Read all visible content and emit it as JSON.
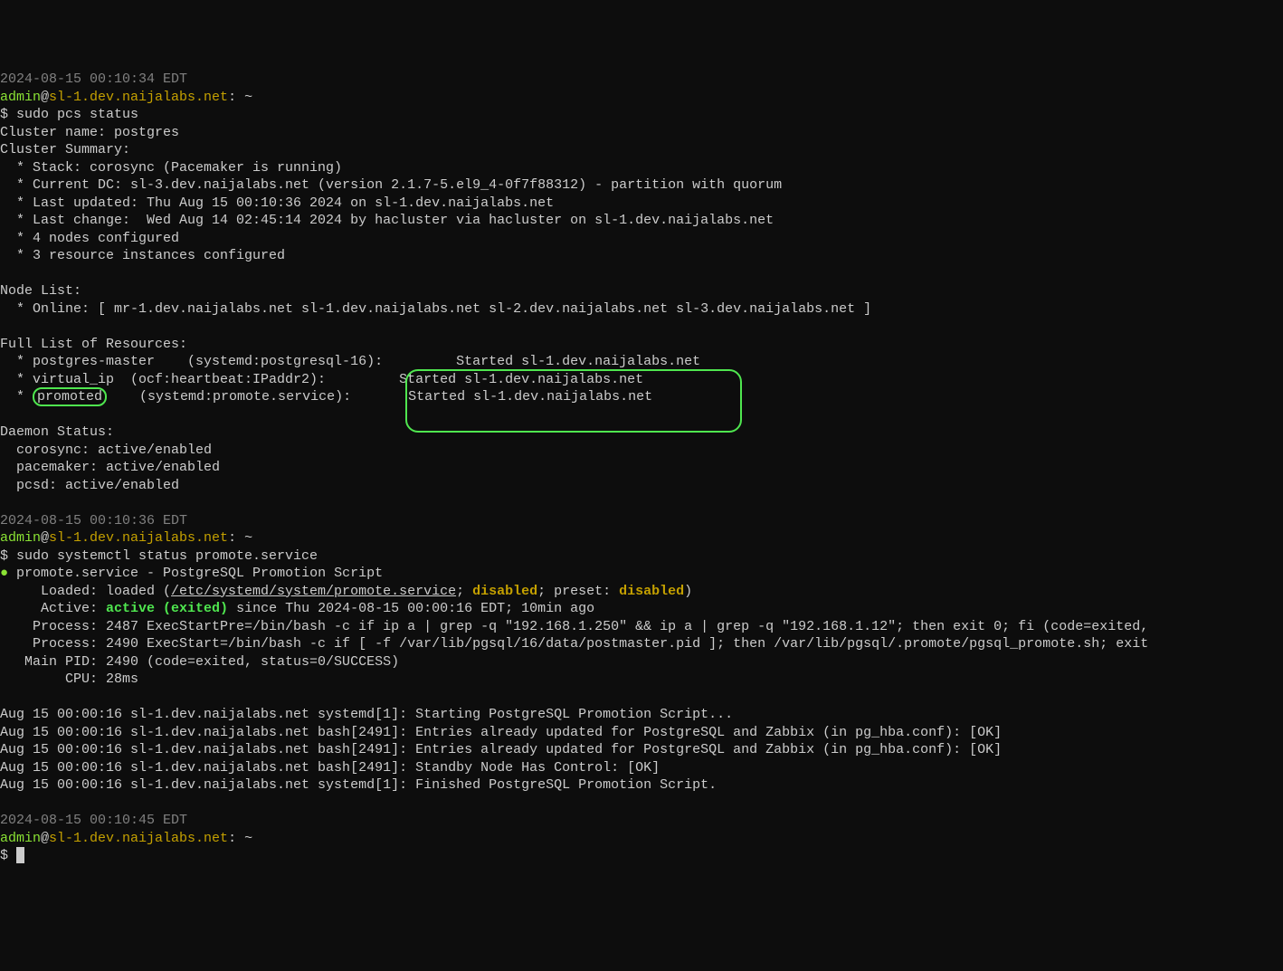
{
  "ts1": "2024-08-15 00:10:34 EDT",
  "user": "admin",
  "at": "@",
  "host": "sl-1.dev.naijalabs.net",
  "prompt_tail": ": ~",
  "cmd1": "$ sudo pcs status",
  "cluster_name": "Cluster name: postgres",
  "cluster_summary": "Cluster Summary:",
  "stack": "  * Stack: corosync (Pacemaker is running)",
  "dc": "  * Current DC: sl-3.dev.naijalabs.net (version 2.1.7-5.el9_4-0f7f88312) - partition with quorum",
  "last_updated": "  * Last updated: Thu Aug 15 00:10:36 2024 on sl-1.dev.naijalabs.net",
  "last_change": "  * Last change:  Wed Aug 14 02:45:14 2024 by hacluster via hacluster on sl-1.dev.naijalabs.net",
  "nodes_conf": "  * 4 nodes configured",
  "res_conf": "  * 3 resource instances configured",
  "node_list_hdr": "Node List:",
  "node_list": "  * Online: [ mr-1.dev.naijalabs.net sl-1.dev.naijalabs.net sl-2.dev.naijalabs.net sl-3.dev.naijalabs.net ]",
  "full_list_hdr": "Full List of Resources:",
  "res1_a": "  * postgres-master    (systemd:postgresql-16):",
  "res1_b": "         Started sl-1.dev.naijalabs.net",
  "res2": "  * virtual_ip  (ocf:heartbeat:IPaddr2):         Started sl-1.dev.naijalabs.net",
  "res3_a": "  * ",
  "res3_hl": "promoted",
  "res3_b": "    (systemd:promote.service):       Started sl-1.dev.naijalabs.net",
  "daemon_hdr": "Daemon Status:",
  "d1": "  corosync: active/enabled",
  "d2": "  pacemaker: active/enabled",
  "d3": "  pcsd: active/enabled",
  "ts2": "2024-08-15 00:10:36 EDT",
  "cmd2": "$ sudo systemctl status promote.service",
  "bullet": "●",
  "svc_line": " promote.service - PostgreSQL Promotion Script",
  "loaded_a": "     Loaded: loaded (",
  "loaded_path": "/etc/systemd/system/promote.service",
  "loaded_mid": "; ",
  "disabled1": "disabled",
  "loaded_pre": "; preset: ",
  "disabled2": "disabled",
  "loaded_end": ")",
  "active_a": "     Active: ",
  "active_b": "active (exited)",
  "active_c": " since Thu 2024-08-15 00:00:16 EDT; 10min ago",
  "proc1": "    Process: 2487 ExecStartPre=/bin/bash -c if ip a | grep -q \"192.168.1.250\" && ip a | grep -q \"192.168.1.12\"; then exit 0; fi (code=exited,",
  "proc2": "    Process: 2490 ExecStart=/bin/bash -c if [ -f /var/lib/pgsql/16/data/postmaster.pid ]; then /var/lib/pgsql/.promote/pgsql_promote.sh; exit",
  "mainpid": "   Main PID: 2490 (code=exited, status=0/SUCCESS)",
  "cpu": "        CPU: 28ms",
  "log1": "Aug 15 00:00:16 sl-1.dev.naijalabs.net systemd[1]: Starting PostgreSQL Promotion Script...",
  "log2": "Aug 15 00:00:16 sl-1.dev.naijalabs.net bash[2491]: Entries already updated for PostgreSQL and Zabbix (in pg_hba.conf): [OK]",
  "log3": "Aug 15 00:00:16 sl-1.dev.naijalabs.net bash[2491]: Entries already updated for PostgreSQL and Zabbix (in pg_hba.conf): [OK]",
  "log4": "Aug 15 00:00:16 sl-1.dev.naijalabs.net bash[2491]: Standby Node Has Control: [OK]",
  "log5": "Aug 15 00:00:16 sl-1.dev.naijalabs.net systemd[1]: Finished PostgreSQL Promotion Script.",
  "ts3": "2024-08-15 00:10:45 EDT",
  "prompt_dollar": "$ "
}
